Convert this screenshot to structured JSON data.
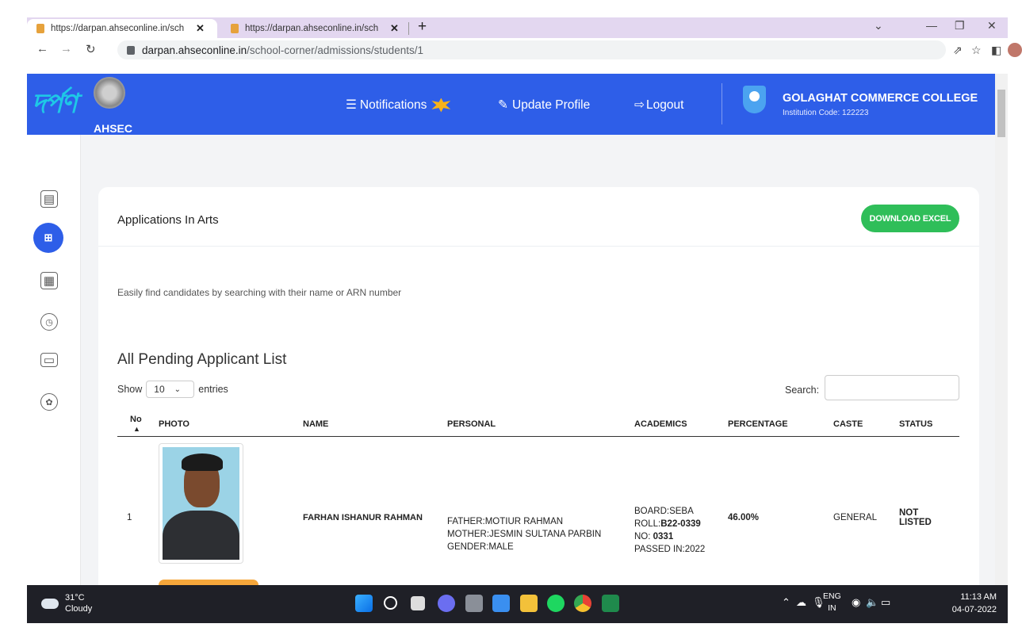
{
  "browser": {
    "tabs": [
      {
        "title": "https://darpan.ahseconline.in/sch"
      },
      {
        "title": "https://darpan.ahseconline.in/sch"
      }
    ],
    "url_host": "darpan.ahseconline.in",
    "url_path": "/school-corner/admissions/students/1"
  },
  "header": {
    "logo_text": "দৰ্পণ",
    "org": "AHSEC",
    "nav": {
      "notifications": "Notifications",
      "update_profile": "Update Profile",
      "logout": "Logout"
    },
    "college_name": "GOLAGHAT COMMERCE COLLEGE",
    "institution_code": "Institution Code: 122223"
  },
  "sidebar": {
    "icons": [
      "dashboard-icon",
      "add-app-icon",
      "form-icon",
      "clock-icon",
      "card-icon",
      "support-icon"
    ]
  },
  "card": {
    "title": "Applications In Arts",
    "download_label": "DOWNLOAD EXCEL",
    "hint": "Easily find candidates by searching with their name or ARN number",
    "list_title": "All Pending Applicant List",
    "show_label": "Show",
    "show_value": "10",
    "entries_label": "entries",
    "search_label": "Search:"
  },
  "table": {
    "headers": [
      "No",
      "PHOTO",
      "NAME",
      "PERSONAL",
      "ACADEMICS",
      "PERCENTAGE",
      "CASTE",
      "STATUS"
    ],
    "rows": [
      {
        "no": "1",
        "name": "FARHAN ISHANUR RAHMAN",
        "father": "FATHER:MOTIUR RAHMAN",
        "mother": "MOTHER:JESMIN SULTANA PARBIN",
        "gender": "GENDER:MALE",
        "board": "BOARD:SEBA",
        "roll_label": "ROLL:",
        "roll": "B22-0339",
        "no_label": "NO: ",
        "no_value": "0331",
        "passed": "PASSED IN:2022",
        "percentage": "46.00%",
        "caste": "GENERAL",
        "status": "NOT LISTED"
      }
    ]
  },
  "taskbar": {
    "temp": "31°C",
    "weather": "Cloudy",
    "lang1": "ENG",
    "lang2": "IN",
    "time": "11:13 AM",
    "date": "04-07-2022"
  }
}
